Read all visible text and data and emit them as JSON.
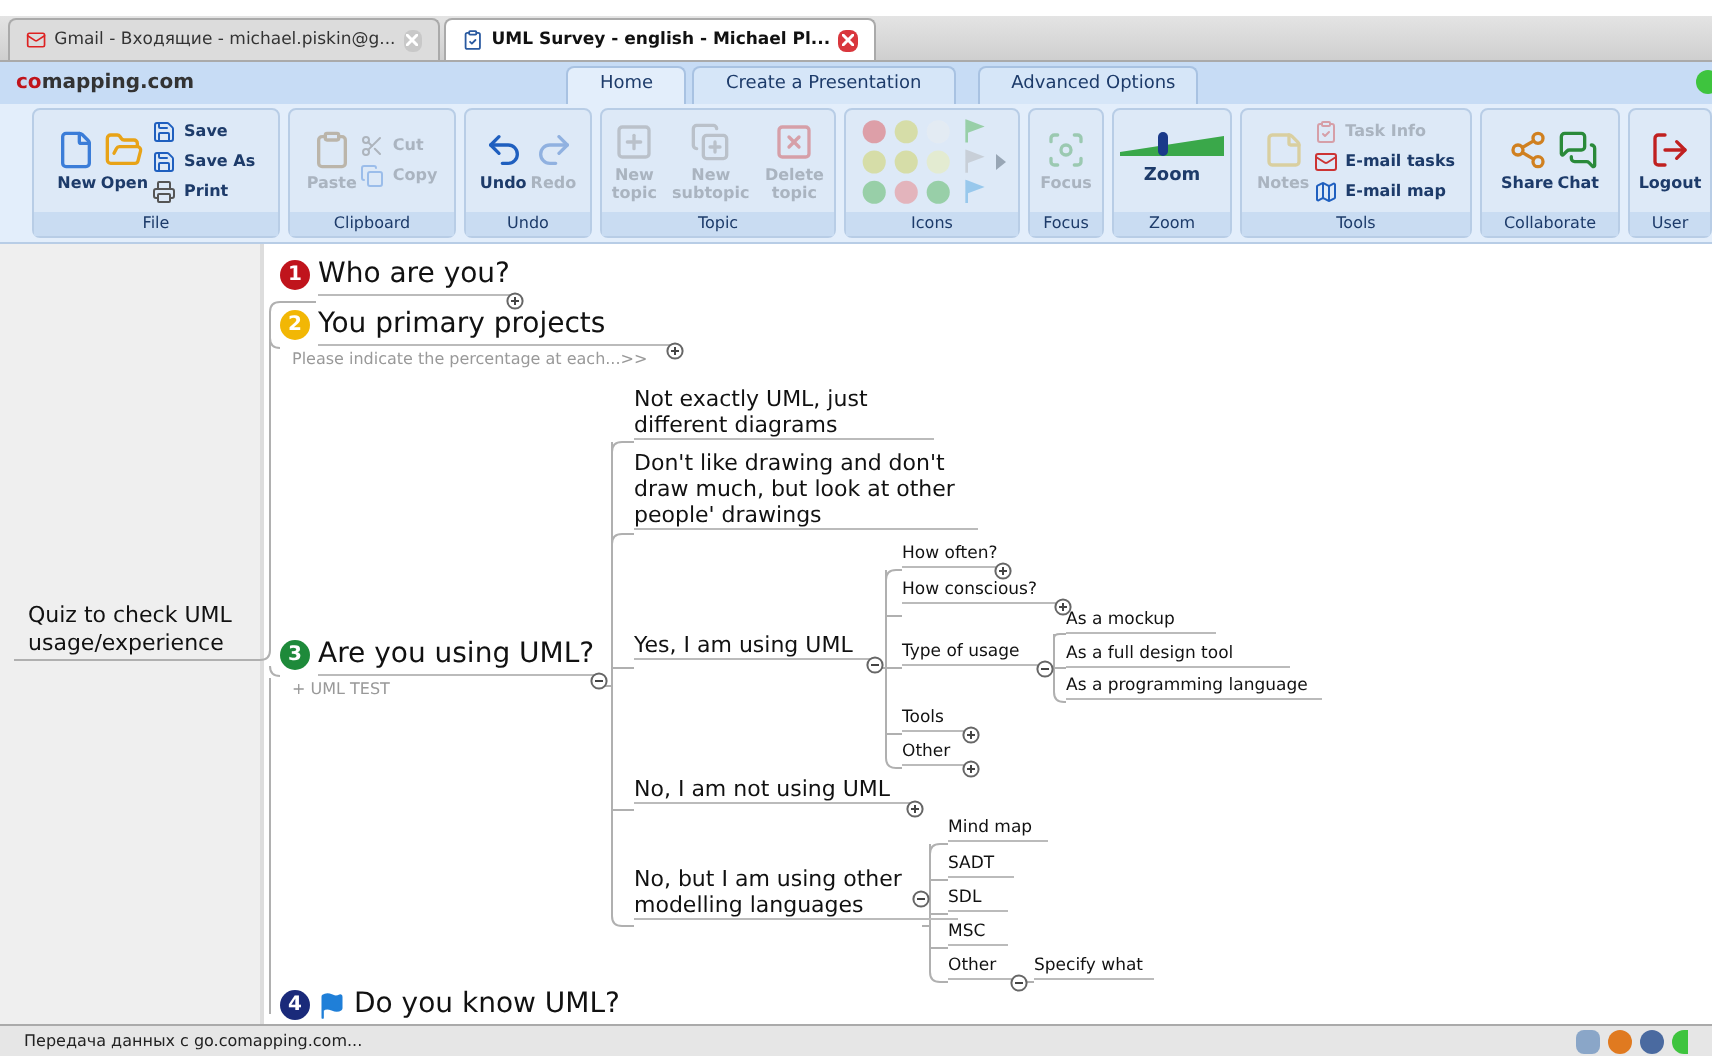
{
  "browser_tabs": [
    {
      "title": "Gmail - Входящие - michael.piskin@g...",
      "selected": false
    },
    {
      "title": "UML Survey - english - Michael Pl...",
      "selected": true
    }
  ],
  "app": {
    "logo": "comapping.com",
    "tabs": [
      {
        "label": "Home",
        "selected": true
      },
      {
        "label": "Create a Presentation",
        "selected": false
      },
      {
        "label": "Advanced Options",
        "selected": false
      }
    ]
  },
  "ribbon": [
    {
      "label": "File",
      "items": [
        {
          "label": "New",
          "kind": "large",
          "disabled": false
        },
        {
          "label": "Open",
          "kind": "large",
          "disabled": false
        },
        {
          "label": "Save",
          "kind": "small",
          "disabled": false
        },
        {
          "label": "Save As",
          "kind": "small",
          "disabled": false
        },
        {
          "label": "Print",
          "kind": "small",
          "disabled": false
        }
      ]
    },
    {
      "label": "Clipboard",
      "items": [
        {
          "label": "Paste",
          "kind": "large",
          "disabled": true
        },
        {
          "label": "Cut",
          "kind": "small",
          "disabled": true
        },
        {
          "label": "Copy",
          "kind": "small",
          "disabled": true
        }
      ]
    },
    {
      "label": "Undo",
      "items": [
        {
          "label": "Undo",
          "kind": "large",
          "disabled": false
        },
        {
          "label": "Redo",
          "kind": "large",
          "disabled": true
        }
      ]
    },
    {
      "label": "Topic",
      "items": [
        {
          "label": "New topic",
          "kind": "large",
          "disabled": true
        },
        {
          "label": "New subtopic",
          "kind": "large",
          "disabled": true
        },
        {
          "label": "Delete topic",
          "kind": "large",
          "disabled": true
        }
      ]
    },
    {
      "label": "Icons",
      "items": [
        {
          "kind": "palette",
          "disabled": true
        }
      ]
    },
    {
      "label": "Focus",
      "items": [
        {
          "label": "Focus",
          "kind": "large",
          "disabled": true
        }
      ]
    },
    {
      "label": "Zoom",
      "items": [
        {
          "label": "Zoom",
          "kind": "slider",
          "level": 0.4
        }
      ]
    },
    {
      "label": "Tools",
      "items": [
        {
          "label": "Notes",
          "kind": "large",
          "disabled": true
        },
        {
          "label": "Task Info",
          "kind": "small",
          "disabled": true
        },
        {
          "label": "E-mail tasks",
          "kind": "small",
          "disabled": false
        },
        {
          "label": "E-mail map",
          "kind": "small",
          "disabled": false
        }
      ]
    },
    {
      "label": "Collaborate",
      "items": [
        {
          "label": "Share",
          "kind": "large",
          "disabled": false
        },
        {
          "label": "Chat",
          "kind": "large",
          "disabled": false
        }
      ]
    },
    {
      "label": "User",
      "items": [
        {
          "label": "Logout",
          "kind": "large",
          "disabled": false
        }
      ]
    }
  ],
  "map": {
    "root": "Quiz to check UML usage/experience",
    "topics": [
      {
        "number": "1",
        "color": "#c0141c",
        "title": "Who are you?",
        "collapsed": true
      },
      {
        "number": "2",
        "color": "#f2b705",
        "title": "You primary projects",
        "note": "Please indicate the percentage at each...>>",
        "collapsed": true
      },
      {
        "number": "3",
        "color": "#1e8a3a",
        "title": "Are you using UML?",
        "note": "+ UML TEST",
        "collapsed": false,
        "children": [
          {
            "title": "Not exactly UML, just different diagrams"
          },
          {
            "title": "Don't like drawing and don't draw much, but look at other people' drawings"
          },
          {
            "title": "Yes, I am using UML",
            "collapsed": false,
            "children": [
              {
                "title": "How often?",
                "collapsed": true
              },
              {
                "title": "How conscious?",
                "collapsed": true
              },
              {
                "title": "Type of usage",
                "collapsed": false,
                "children": [
                  {
                    "title": "As a mockup"
                  },
                  {
                    "title": "As a full design tool"
                  },
                  {
                    "title": "As a programming language"
                  }
                ]
              },
              {
                "title": "Tools",
                "collapsed": true
              },
              {
                "title": "Other",
                "collapsed": true
              }
            ]
          },
          {
            "title": "No, I am not using UML",
            "collapsed": true
          },
          {
            "title": "No, but I am using other modelling languages",
            "collapsed": false,
            "children": [
              {
                "title": "Mind map"
              },
              {
                "title": "SADT"
              },
              {
                "title": "SDL"
              },
              {
                "title": "MSC"
              },
              {
                "title": "Other",
                "collapsed": false,
                "children": [
                  {
                    "title": "Specify what"
                  }
                ]
              }
            ]
          }
        ]
      },
      {
        "number": "4",
        "color": "#1a2a7a",
        "flag": true,
        "title": "Do you know UML?"
      }
    ]
  },
  "status_bar": "Передача данных с go.comapping.com..."
}
